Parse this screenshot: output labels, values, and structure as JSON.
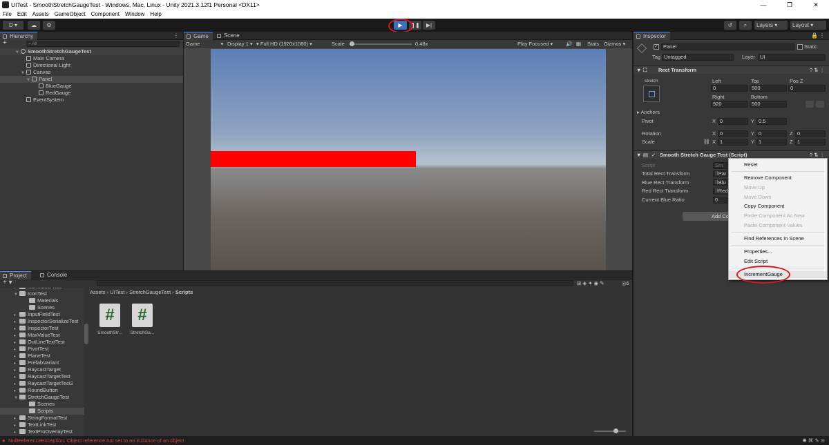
{
  "window": {
    "title": "UITest - SmoothStretchGaugeTest - Windows, Mac, Linux - Unity 2021.3.12f1 Personal <DX11>",
    "controls": [
      "—",
      "❐",
      "✕"
    ]
  },
  "menu": [
    "File",
    "Edit",
    "Assets",
    "GameObject",
    "Component",
    "Window",
    "Help"
  ],
  "toolbar": {
    "account": "D ▾",
    "layers": "Layers",
    "layout": "Layout"
  },
  "hierarchy": {
    "tab": "Hierarchy",
    "search_placeholder": "All",
    "items": [
      "SmoothStretchGaugeTest",
      "Main Camera",
      "Directional Light",
      "Canvas",
      "Panel",
      "BlueGauge",
      "RedGauge",
      "EventSystem"
    ]
  },
  "game": {
    "tab_game": "Game",
    "tab_scene": "Scene",
    "mode": "Game",
    "display": "Display 1",
    "resolution": "Full HD (1920x1080)",
    "scale_label": "Scale",
    "scale_value": "0.48x",
    "play_focused": "Play Focused",
    "stats": "Stats",
    "gizmos": "Gizmos",
    "red_gauge_fill": 0.5
  },
  "inspector": {
    "tab": "Inspector",
    "object_name": "Panel",
    "static": "Static",
    "tag_label": "Tag",
    "tag": "Untagged",
    "layer_label": "Layer",
    "layer": "UI",
    "rect_transform": "Rect Transform",
    "stretch": "stretch",
    "left_label": "Left",
    "left": "0",
    "top_label": "Top",
    "top": "500",
    "posz_label": "Pos Z",
    "posz": "0",
    "right_label": "Right",
    "right": "920",
    "bottom_label": "Bottom",
    "bottom": "500",
    "anchors": "Anchors",
    "pivot_label": "Pivot",
    "pivot_x": "0",
    "pivot_y": "0.5",
    "rotation_label": "Rotation",
    "rot_x": "0",
    "rot_y": "0",
    "rot_z": "0",
    "scale_label": "Scale",
    "scale_x": "1",
    "scale_y": "1",
    "scale_z": "1",
    "x": "X",
    "y": "Y",
    "z": "Z",
    "component": "Smooth Stretch Gauge Test (Script)",
    "script_label": "Script",
    "script_value": "Sm",
    "total_rect_label": "Total Rect Transform",
    "total_rect_value": "Par",
    "blue_rect_label": "Blue Rect Transform",
    "blue_rect_value": "Blu",
    "red_rect_label": "Red Rect Transform",
    "red_rect_value": "Red",
    "current_blue_label": "Current Blue Ratio",
    "current_blue_value": "0",
    "add_component": "Add Co"
  },
  "context_menu": {
    "reset": "Reset",
    "remove": "Remove Component",
    "move_up": "Move Up",
    "move_down": "Move Down",
    "copy": "Copy Component",
    "paste_new": "Paste Component As New",
    "paste_values": "Paste Component Values",
    "find_refs": "Find References In Scene",
    "properties": "Properties...",
    "edit_script": "Edit Script",
    "increment": "IncrementGauge"
  },
  "project": {
    "tab_project": "Project",
    "tab_console": "Console",
    "breadcrumb": [
      "Assets",
      "UITest",
      "StretchGaugeTest",
      "Scripts"
    ],
    "badge": "6",
    "folders": [
      "IconMakerTest",
      "IconTest",
      "Materials",
      "Scenes",
      "InputFieldTest",
      "InspectorSerializeTest",
      "InspectorTest",
      "MaxValueTest",
      "OutLineTextTest",
      "PivotTest",
      "PlaneTest",
      "PrefabVariant",
      "RaycastTarget",
      "RaycastTargetTest",
      "RaycastTargetTest2",
      "RoundButton",
      "StretchGaugeTest",
      "Scenes",
      "Scripts",
      "StringFormatTest",
      "TextLinkTest",
      "TextProOverlayTest"
    ],
    "assets": [
      "SmoothStr...",
      "StretchGa..."
    ],
    "script_glyph": "#"
  },
  "status": "NullReferenceException: Object reference not set to an instance of an object",
  "colors": {
    "red_gauge": "#ff0000",
    "annotation": "#d11820",
    "accent": "#4d8cf5"
  }
}
